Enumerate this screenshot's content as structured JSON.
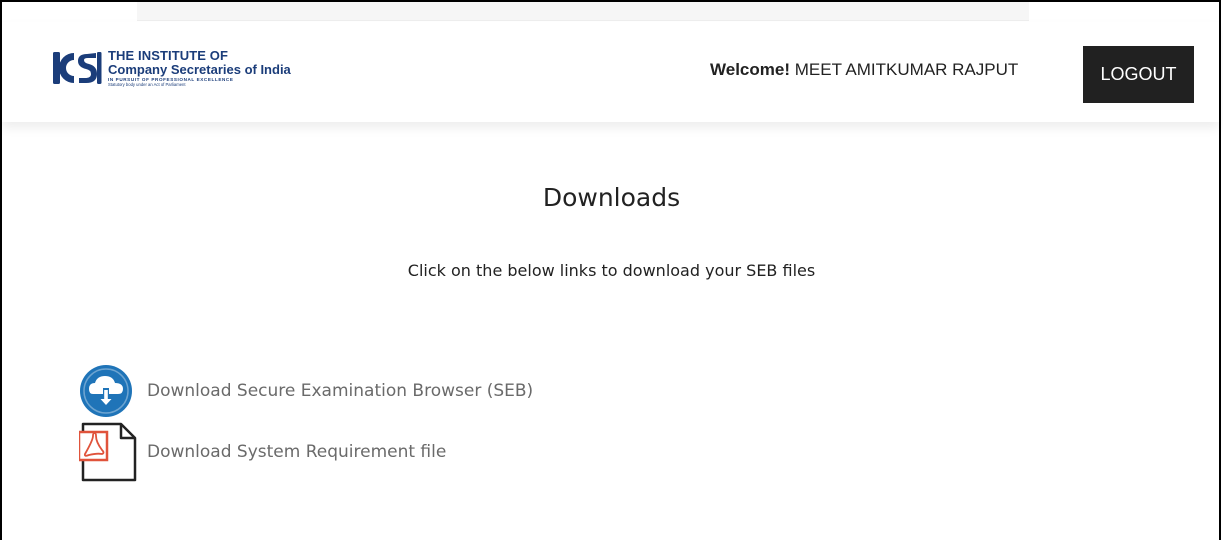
{
  "header": {
    "logo": {
      "line1": "THE INSTITUTE OF",
      "line2": "Company Secretaries of India",
      "line3": "IN PURSUIT OF PROFESSIONAL EXCELLENCE",
      "line4": "Statutory body under an Act of Parliament",
      "mark_text": "ICSI"
    },
    "welcome_label": "Welcome!",
    "user_name": "MEET AMITKUMAR RAJPUT",
    "logout_label": "LOGOUT"
  },
  "main": {
    "title": "Downloads",
    "subtitle": "Click on the below links to download your SEB files",
    "links": [
      {
        "label": "Download Secure Examination Browser (SEB)",
        "icon": "cloud-download-icon"
      },
      {
        "label": "Download System Requirement file",
        "icon": "pdf-file-icon"
      }
    ]
  },
  "colors": {
    "brand": "#1b3d7a",
    "logout_bg": "#212121",
    "download_icon_blue": "#1f74b8",
    "pdf_red": "#e0533b",
    "link_text": "#6a6a6a"
  }
}
